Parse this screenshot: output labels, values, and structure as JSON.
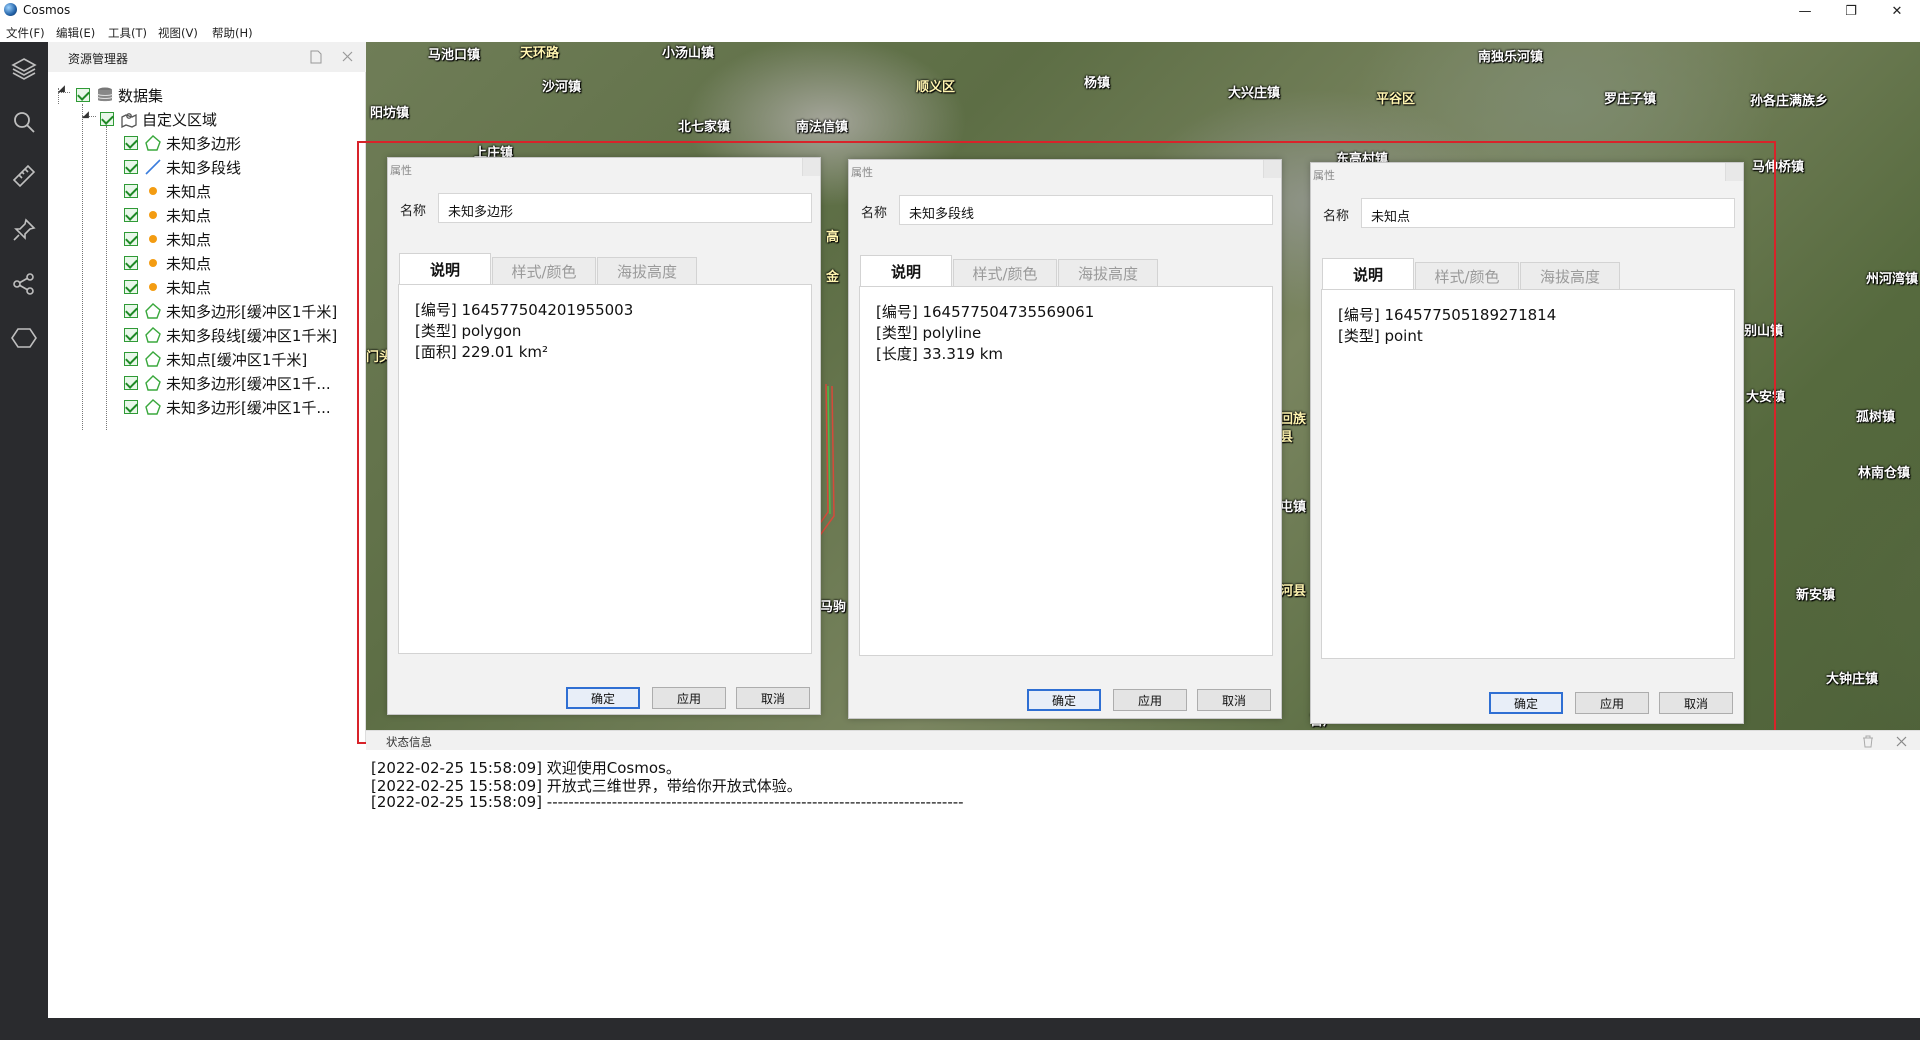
{
  "app": {
    "title": "Cosmos",
    "logo_icon": "globe-icon"
  },
  "window_controls": {
    "minimize": "—",
    "maximize": "❐",
    "close": "✕"
  },
  "menu": [
    "文件(F)",
    "编辑(E)",
    "工具(T)",
    "视图(V)",
    "帮助(H)"
  ],
  "sidebar_icons": [
    "layers-icon",
    "search-icon",
    "ruler-icon",
    "pin-icon",
    "share-icon",
    "hexagon-icon"
  ],
  "explorer": {
    "title": "资源管理器",
    "root": {
      "label": "数据集",
      "icon": "database-icon"
    },
    "group": {
      "label": "自定义区域",
      "icon": "map-pin-icon"
    },
    "items": [
      {
        "label": "未知多边形",
        "icon": "polygon-icon"
      },
      {
        "label": "未知多段线",
        "icon": "polyline-icon"
      },
      {
        "label": "未知点",
        "icon": "point-icon"
      },
      {
        "label": "未知点",
        "icon": "point-icon"
      },
      {
        "label": "未知点",
        "icon": "point-icon"
      },
      {
        "label": "未知点",
        "icon": "point-icon"
      },
      {
        "label": "未知点",
        "icon": "point-icon"
      },
      {
        "label": "未知多边形[缓冲区1千米]",
        "icon": "polygon-icon"
      },
      {
        "label": "未知多段线[缓冲区1千米]",
        "icon": "polygon-icon"
      },
      {
        "label": "未知点[缓冲区1千米]",
        "icon": "polygon-icon"
      },
      {
        "label": "未知多边形[缓冲区1千...",
        "icon": "polygon-icon"
      },
      {
        "label": "未知多边形[缓冲区1千...",
        "icon": "polygon-icon"
      }
    ]
  },
  "map_labels": [
    "马池口镇",
    "天环路",
    "小汤山镇",
    "南独乐河镇",
    "阳坊镇",
    "沙河镇",
    "顺义区",
    "杨镇",
    "大兴庄镇",
    "平谷区",
    "罗庄子镇",
    "孙各庄满族乡",
    "北七家镇",
    "南法信镇",
    "上庄镇",
    "东高村镇",
    "马伸桥镇",
    "州河湾镇",
    "别山镇",
    "大安镇",
    "孤树镇",
    "林南仓镇",
    "新安镇",
    "大钟庄镇",
    "回族",
    "县",
    "屯镇",
    "河县",
    "百户",
    "高",
    "金",
    "马驹",
    "门头"
  ],
  "dialogs": [
    {
      "title": "属性",
      "name_label": "名称",
      "name_value": "未知多边形",
      "tabs": [
        "说明",
        "样式/颜色",
        "海拔高度"
      ],
      "info": [
        "[编号] 164577504201955003",
        "[类型] polygon",
        "[面积] 229.01 km²"
      ],
      "buttons": [
        "确定",
        "应用",
        "取消"
      ]
    },
    {
      "title": "属性",
      "name_label": "名称",
      "name_value": "未知多段线",
      "tabs": [
        "说明",
        "样式/颜色",
        "海拔高度"
      ],
      "info": [
        "[编号] 164577504735569061",
        "[类型] polyline",
        "[长度] 33.319 km"
      ],
      "buttons": [
        "确定",
        "应用",
        "取消"
      ]
    },
    {
      "title": "属性",
      "name_label": "名称",
      "name_value": "未知点",
      "tabs": [
        "说明",
        "样式/颜色",
        "海拔高度"
      ],
      "info": [
        "[编号] 164577505189271814",
        "[类型] point"
      ],
      "buttons": [
        "确定",
        "应用",
        "取消"
      ]
    }
  ],
  "status": {
    "title": "状态信息",
    "trash_icon": "trash-icon",
    "close_icon": "close-icon"
  },
  "log": [
    "[2022-02-25 15:58:09] 欢迎使用Cosmos。",
    "[2022-02-25 15:58:09] 开放式三维世界，带给你开放式体验。",
    "[2022-02-25 15:58:09] -----------------------------------------------------------------------------"
  ],
  "colors": {
    "sidebar": "#2a2b2e",
    "highlight_frame": "#d8232a",
    "primary_button": "#2f6fd3",
    "point": "#f39c12",
    "polyline": "#3b7ddd",
    "polygon": "#3aa83d"
  }
}
